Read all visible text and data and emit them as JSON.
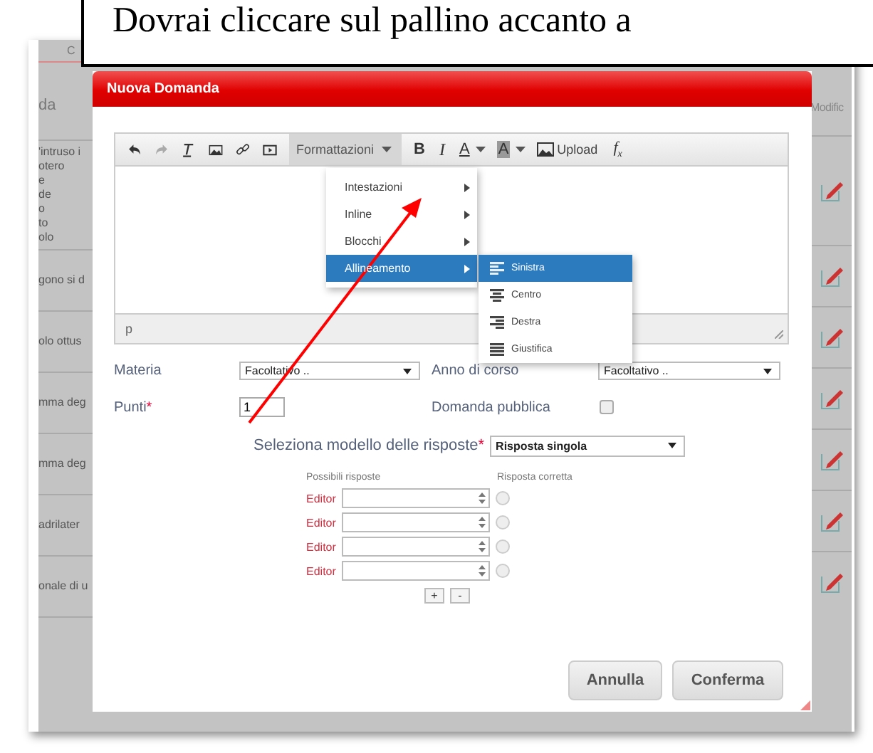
{
  "callout": {
    "text": "Dovrai cliccare sul pallino accanto a"
  },
  "background_table": {
    "tab": "C",
    "left_header": "da",
    "right_header": "Modific",
    "rows": [
      {
        "text": "'intruso i\notero\ne\nde\no\nto\nolo"
      },
      {
        "text": "gono si d"
      },
      {
        "text": "olo ottus"
      },
      {
        "text": "mma deg"
      },
      {
        "text": "mma deg"
      },
      {
        "text": "adrilater"
      },
      {
        "text": "onale di u"
      }
    ]
  },
  "dialog": {
    "title": "Nuova Domanda",
    "toolbar": {
      "format_button": "Formattazioni",
      "bold": "B",
      "italic": "I",
      "text_color": "A",
      "background_color": "A",
      "upload": "Upload",
      "formula": "f$_{x}$"
    },
    "format_menu": [
      {
        "label": "Intestazioni",
        "selected": false
      },
      {
        "label": "Inline",
        "selected": false
      },
      {
        "label": "Blocchi",
        "selected": false
      },
      {
        "label": "Allineamento",
        "selected": true
      }
    ],
    "alignment_menu": [
      {
        "label": "Sinistra",
        "kind": "left",
        "selected": true
      },
      {
        "label": "Centro",
        "kind": "center",
        "selected": false
      },
      {
        "label": "Destra",
        "kind": "right",
        "selected": false
      },
      {
        "label": "Giustifica",
        "kind": "justify",
        "selected": false
      }
    ],
    "editor_path": "p",
    "materia": {
      "label": "Materia",
      "value": "Facoltativo .."
    },
    "anno": {
      "label": "Anno di corso",
      "value": "Facoltativo .."
    },
    "punti": {
      "label": "Punti",
      "required_mark": "*",
      "value": "1"
    },
    "pubblica": {
      "label": "Domanda pubblica",
      "checked": false
    },
    "modello": {
      "label": "Seleziona modello delle risposte",
      "required_mark": "*",
      "value": "Risposta singola"
    },
    "answers_header": {
      "answers": "Possibili risposte",
      "correct": "Risposta corretta"
    },
    "answers": [
      {
        "label": "Editor",
        "selected": false
      },
      {
        "label": "Editor",
        "selected": false
      },
      {
        "label": "Editor",
        "selected": false
      },
      {
        "label": "Editor",
        "selected": false
      }
    ],
    "add_button": "+",
    "remove_button": "-",
    "buttons": [
      "Annulla",
      "Conferma"
    ]
  }
}
